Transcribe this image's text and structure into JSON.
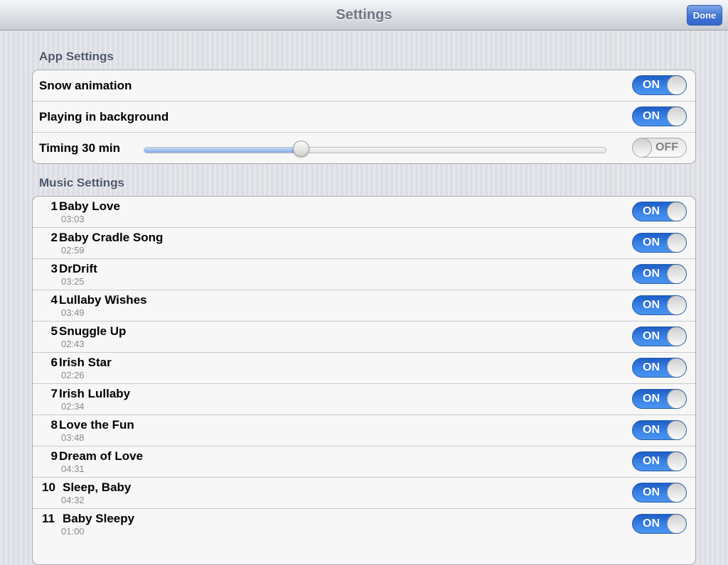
{
  "navbar": {
    "title": "Settings",
    "done_label": "Done"
  },
  "app_settings": {
    "header": "App Settings",
    "snow_animation": {
      "label": "Snow animation",
      "toggle": "ON"
    },
    "playing_background": {
      "label": "Playing in background",
      "toggle": "ON"
    },
    "timing": {
      "label": "Timing 30 min",
      "slider_value": 0.34,
      "toggle": "OFF"
    }
  },
  "music_settings": {
    "header": "Music Settings",
    "songs": [
      {
        "num": "1",
        "title": "Baby Love",
        "time": "03:03",
        "toggle": "ON"
      },
      {
        "num": "2",
        "title": "Baby Cradle Song",
        "time": "02:59",
        "toggle": "ON"
      },
      {
        "num": "3",
        "title": "DrDrift",
        "time": "03:25",
        "toggle": "ON"
      },
      {
        "num": "4",
        "title": "Lullaby Wishes",
        "time": "03:49",
        "toggle": "ON"
      },
      {
        "num": "5",
        "title": "Snuggle Up",
        "time": "02:43",
        "toggle": "ON"
      },
      {
        "num": "6",
        "title": "Irish Star",
        "time": "02:26",
        "toggle": "ON"
      },
      {
        "num": "7",
        "title": "Irish Lullaby",
        "time": "02:34",
        "toggle": "ON"
      },
      {
        "num": "8",
        "title": "Love the Fun",
        "time": "03:48",
        "toggle": "ON"
      },
      {
        "num": "9",
        "title": "Dream of Love",
        "time": "04:31",
        "toggle": "ON"
      },
      {
        "num": "10",
        "title": "Sleep, Baby",
        "time": "04:32",
        "toggle": "ON"
      },
      {
        "num": "11",
        "title": "Baby Sleepy",
        "time": "01:00",
        "toggle": "ON"
      }
    ]
  },
  "colors": {
    "accent": "#3b86e8",
    "done_button": "#3f72d4"
  }
}
